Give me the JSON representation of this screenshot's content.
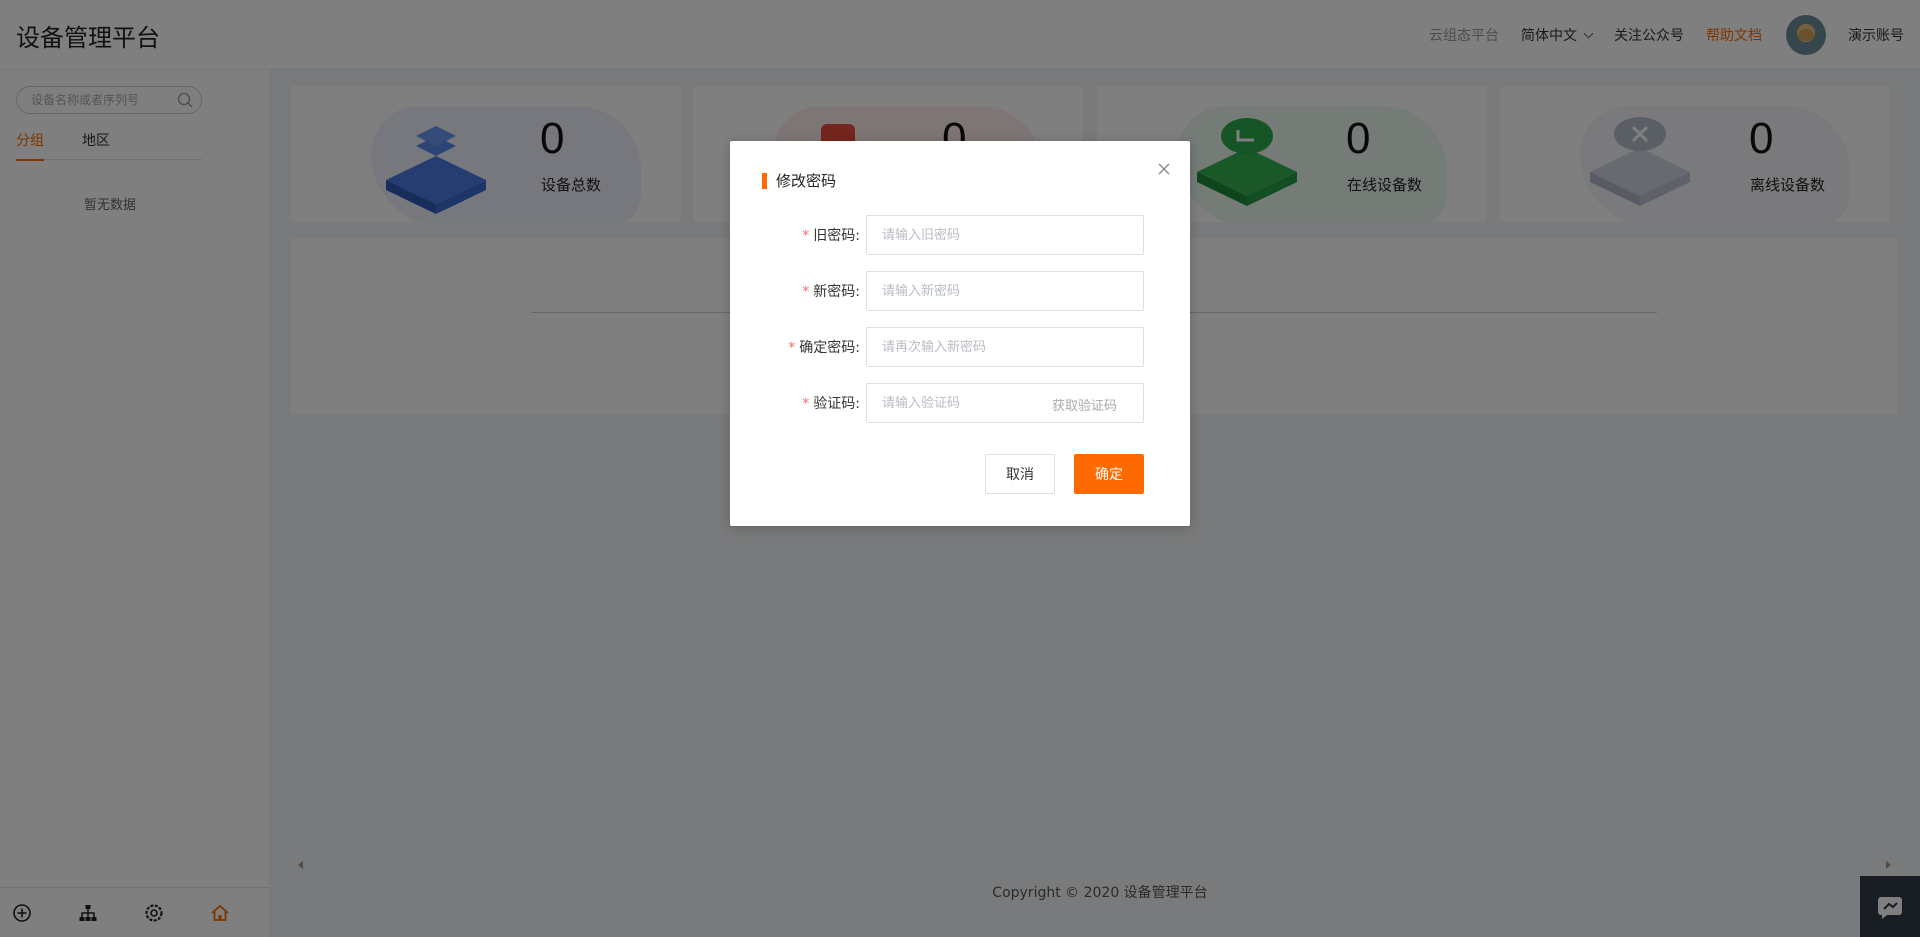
{
  "header": {
    "title": "设备管理平台",
    "nav": {
      "cloud_platform": "云组态平台",
      "language": "简体中文",
      "follow": "关注公众号",
      "help": "帮助文档",
      "account": "演示账号"
    }
  },
  "sidebar": {
    "search_placeholder": "设备名称或者序列号",
    "tabs": [
      "分组",
      "地区"
    ],
    "active_tab": "分组",
    "empty_text": "暂无数据",
    "bottom_icons": [
      "add-circle-icon",
      "org-tree-icon",
      "settings-icon",
      "home-icon"
    ]
  },
  "stats": [
    {
      "value": "0",
      "label": "设备总数",
      "color": "#3a6fd6"
    },
    {
      "value": "0",
      "label": "",
      "color": "#e84b3c"
    },
    {
      "value": "0",
      "label": "在线设备数",
      "color": "#2aa84a"
    },
    {
      "value": "0",
      "label": "离线设备数",
      "color": "#b5bccb"
    }
  ],
  "footer": {
    "copyright": "Copyright © 2020 设备管理平台"
  },
  "dialog": {
    "title": "修改密码",
    "fields": {
      "old_password": {
        "label": "旧密码:",
        "placeholder": "请输入旧密码"
      },
      "new_password": {
        "label": "新密码:",
        "placeholder": "请输入新密码"
      },
      "confirm_password": {
        "label": "确定密码:",
        "placeholder": "请再次输入新密码"
      },
      "code": {
        "label": "验证码:",
        "placeholder": "请输入验证码",
        "action": "获取验证码"
      }
    },
    "cancel": "取消",
    "confirm": "确定"
  },
  "colors": {
    "accent": "#ff6a00",
    "required": "#f56c6c"
  }
}
